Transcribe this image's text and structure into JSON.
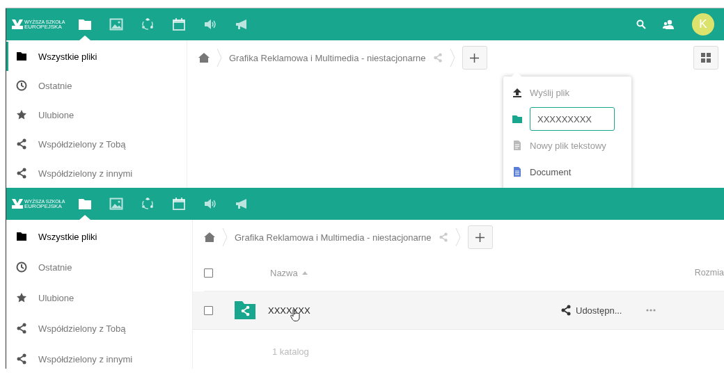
{
  "screens": [
    {
      "kind": "menu_open",
      "header": {
        "logo": {
          "line_1": "WYŻSZA SZKOŁA",
          "line_2": "EUROPEJSKA"
        },
        "apps": [
          {
            "kind": "files",
            "selected": true
          },
          {
            "kind": "gallery",
            "selected": false
          },
          {
            "kind": "circles",
            "selected": false
          },
          {
            "kind": "calendar",
            "selected": false
          },
          {
            "kind": "audio",
            "selected": false
          },
          {
            "kind": "announce",
            "selected": false
          }
        ],
        "tools": [
          {
            "kind": "search"
          },
          {
            "kind": "contacts"
          }
        ],
        "avatar": "K"
      },
      "sidebar": {
        "items": [
          {
            "kind": "folder",
            "label": "Wszystkie pliki",
            "selected": true
          },
          {
            "kind": "clock",
            "label": "Ostatnie",
            "selected": false
          },
          {
            "kind": "star",
            "label": "Ulubione",
            "selected": false
          },
          {
            "kind": "share",
            "label": "Współdzielony z Tobą",
            "selected": false
          },
          {
            "kind": "share",
            "label": "Współdzielony z innymi",
            "selected": false
          }
        ]
      },
      "breadcrumb": {
        "path": "Grafika Reklamowa i Multimedia - niestacjonarne"
      },
      "new_menu": {
        "items": [
          {
            "kind": "upload",
            "label": "Wyślij plik"
          },
          {
            "kind": "new_folder",
            "value": "XXXXXXXXX"
          },
          {
            "kind": "text_file",
            "label": "Nowy plik tekstowy"
          },
          {
            "kind": "document",
            "label": "Document"
          }
        ]
      }
    },
    {
      "kind": "list",
      "header": {
        "logo": {
          "line_1": "WYŻSZA SZKOŁA",
          "line_2": "EUROPEJSKA"
        },
        "apps": [
          {
            "kind": "files",
            "selected": true
          },
          {
            "kind": "gallery",
            "selected": false
          },
          {
            "kind": "circles",
            "selected": false
          },
          {
            "kind": "calendar",
            "selected": false
          },
          {
            "kind": "audio",
            "selected": false
          },
          {
            "kind": "announce",
            "selected": false
          }
        ]
      },
      "sidebar": {
        "items": [
          {
            "kind": "folder",
            "label": "Wszystkie pliki",
            "selected": true
          },
          {
            "kind": "clock",
            "label": "Ostatnie",
            "selected": false
          },
          {
            "kind": "star",
            "label": "Ulubione",
            "selected": false
          },
          {
            "kind": "share",
            "label": "Współdzielony z Tobą",
            "selected": false
          },
          {
            "kind": "share",
            "label": "Współdzielony z innymi",
            "selected": false
          }
        ]
      },
      "breadcrumb": {
        "path": "Grafika Reklamowa i Multimedia - niestacjonarne"
      },
      "table": {
        "all_checked": false,
        "columns": [
          {
            "label": "Nazwa",
            "sort_ascending": true
          },
          {
            "label": "Rozmia"
          }
        ],
        "rows": [
          {
            "name": "XXXXXXX",
            "checked": false,
            "hovered": true,
            "share_label": "Udostępn..."
          }
        ],
        "summary": "1 katalog"
      }
    }
  ]
}
